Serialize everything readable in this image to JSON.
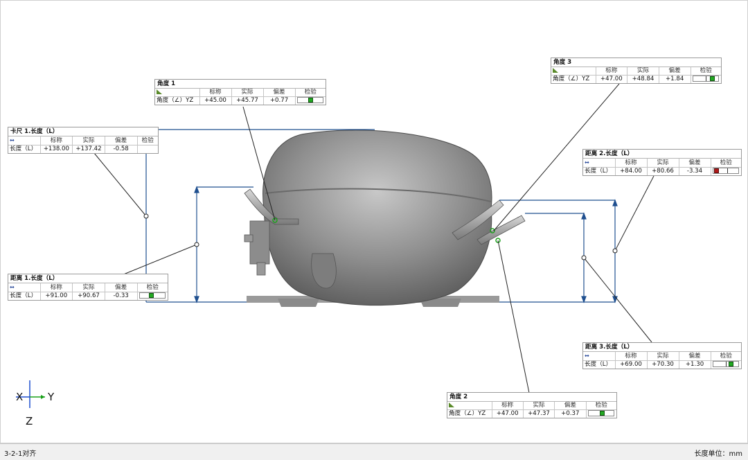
{
  "panels": {
    "angle1": {
      "title": "角度 1",
      "headers": [
        "标称",
        "实际",
        "偏差",
        "检验"
      ],
      "row": {
        "label": "角度（∠）YZ",
        "nominal": "+45.00",
        "actual": "+45.77",
        "deviation": "+0.77",
        "status": "pass"
      }
    },
    "angle3": {
      "title": "角度 3",
      "headers": [
        "标称",
        "实际",
        "偏差",
        "检验"
      ],
      "row": {
        "label": "角度（∠）YZ",
        "nominal": "+47.00",
        "actual": "+48.84",
        "deviation": "+1.84",
        "status": "pass"
      }
    },
    "caliper1": {
      "title": "卡尺 1.长度（L）",
      "headers": [
        "标称",
        "实际",
        "偏差",
        "检验"
      ],
      "row": {
        "label": "长度（L）",
        "nominal": "+138.00",
        "actual": "+137.42",
        "deviation": "-0.58",
        "status": "none"
      }
    },
    "distance2": {
      "title": "距离 2.长度（L）",
      "headers": [
        "标称",
        "实际",
        "偏差",
        "检验"
      ],
      "row": {
        "label": "长度（L）",
        "nominal": "+84.00",
        "actual": "+80.66",
        "deviation": "-3.34",
        "status": "fail"
      }
    },
    "distance1": {
      "title": "距离 1.长度（L）",
      "headers": [
        "标称",
        "实际",
        "偏差",
        "检验"
      ],
      "row": {
        "label": "长度（L）",
        "nominal": "+91.00",
        "actual": "+90.67",
        "deviation": "-0.33",
        "status": "pass"
      }
    },
    "distance3": {
      "title": "距离 3.长度（L）",
      "headers": [
        "标称",
        "实际",
        "偏差",
        "检验"
      ],
      "row": {
        "label": "长度（L）",
        "nominal": "+69.00",
        "actual": "+70.30",
        "deviation": "+1.30",
        "status": "pass"
      }
    },
    "angle2": {
      "title": "角度 2",
      "headers": [
        "标称",
        "实际",
        "偏差",
        "检验"
      ],
      "row": {
        "label": "角度（∠）YZ",
        "nominal": "+47.00",
        "actual": "+47.37",
        "deviation": "+0.37",
        "status": "pass"
      }
    }
  },
  "axis_triad": {
    "x": "X",
    "y": "Y",
    "z": "Z"
  },
  "status_bar": {
    "alignment": "3-2-1对齐",
    "unit": "长度单位：mm"
  },
  "colors": {
    "pass": "#22aa22",
    "fail": "#b01818",
    "dimension_line": "#1f4f8f",
    "leader": "#222222"
  }
}
